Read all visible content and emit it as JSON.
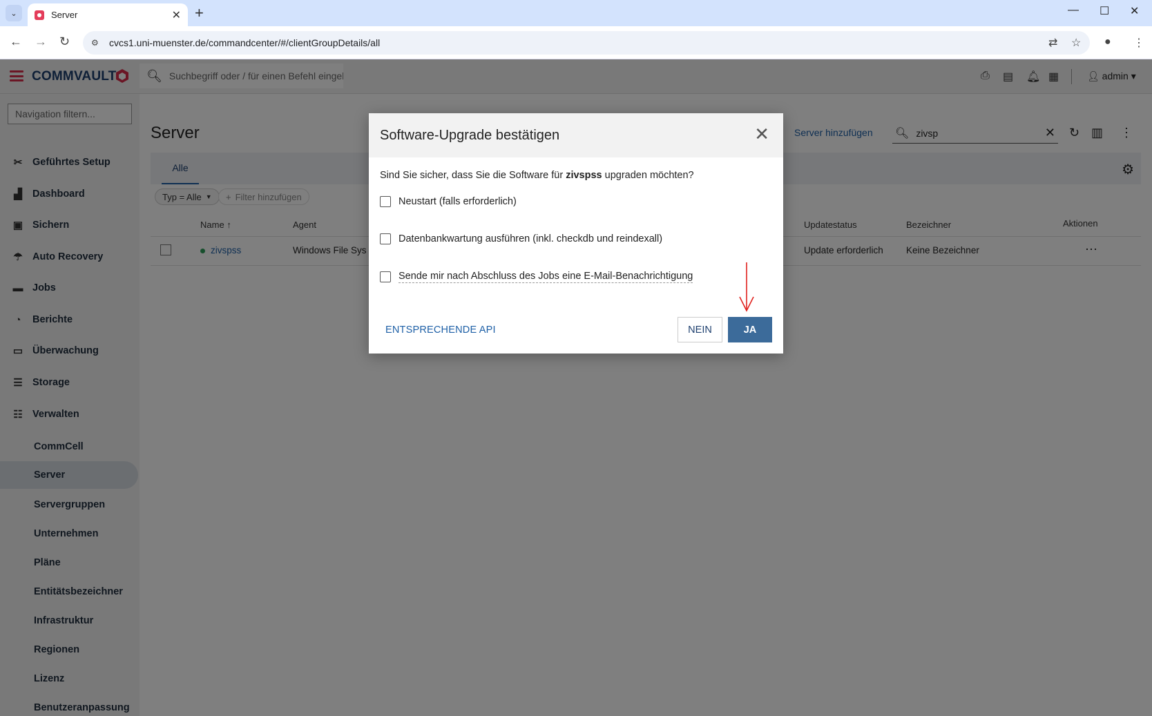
{
  "browser": {
    "tab_title": "Server",
    "url": "cvcs1.uni-muenster.de/commandcenter/#/clientGroupDetails/all"
  },
  "header": {
    "logo_text": "COMMVAULT",
    "search_placeholder": "Suchbegriff oder / für einen Befehl eingeben",
    "user": "admin"
  },
  "sidebar": {
    "filter_placeholder": "Navigation filtern...",
    "items": [
      {
        "label": "Geführtes Setup",
        "icon": "tools-icon"
      },
      {
        "label": "Dashboard",
        "icon": "dashboard-icon"
      },
      {
        "label": "Sichern",
        "icon": "lock-icon"
      },
      {
        "label": "Auto Recovery",
        "icon": "recovery-icon"
      },
      {
        "label": "Jobs",
        "icon": "briefcase-icon"
      },
      {
        "label": "Berichte",
        "icon": "reports-icon"
      },
      {
        "label": "Überwachung",
        "icon": "monitor-icon"
      },
      {
        "label": "Storage",
        "icon": "database-icon"
      },
      {
        "label": "Verwalten",
        "icon": "sliders-icon"
      }
    ],
    "sub_items": [
      "CommCell",
      "Server",
      "Servergruppen",
      "Unternehmen",
      "Pläne",
      "Entitätsbezeichner",
      "Infrastruktur",
      "Regionen",
      "Lizenz",
      "Benutzeranpassung"
    ]
  },
  "main": {
    "title": "Server",
    "add_server": "Server hinzufügen",
    "search_value": "zivsp",
    "tab": "Alle",
    "filter_chip": "Typ = Alle",
    "add_filter": "Filter hinzufügen",
    "columns": {
      "name": "Name",
      "agent": "Agent",
      "update_status": "Updatestatus",
      "tags": "Bezeichner",
      "actions": "Aktionen"
    },
    "rows": [
      {
        "name": "zivspss",
        "agent": "Windows File Sys",
        "update_status": "Update erforderlich",
        "tags": "Keine Bezeichner"
      }
    ]
  },
  "modal": {
    "title": "Software-Upgrade bestätigen",
    "question_prefix": "Sind Sie sicher, dass Sie die Software für",
    "question_client": "zivspss",
    "question_suffix": "upgraden möchten?",
    "options": [
      "Neustart (falls erforderlich)",
      "Datenbankwartung ausführen (inkl. checkdb und reindexall)",
      "Sende mir nach Abschluss des Jobs eine E-Mail-Benachrichtigung"
    ],
    "api_label": "ENTSPRECHENDE API",
    "no_label": "NEIN",
    "yes_label": "JA"
  },
  "colors": {
    "brand_red": "#d62d4b",
    "primary_blue": "#3c6b9a",
    "annotation_arrow": "#e0201c"
  }
}
